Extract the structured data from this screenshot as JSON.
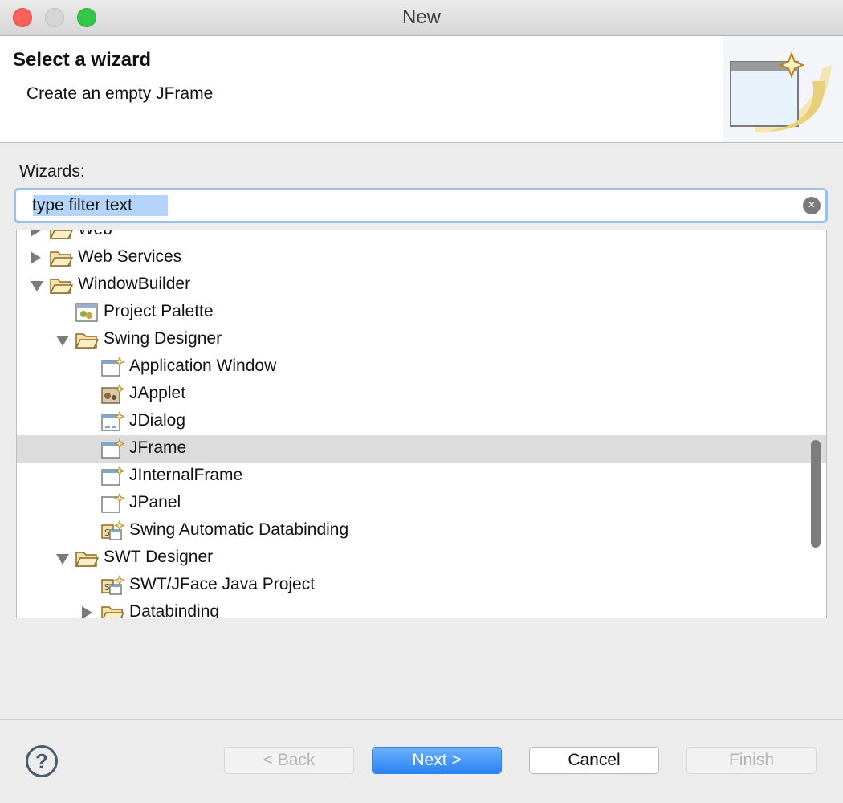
{
  "window": {
    "title": "New"
  },
  "header": {
    "title": "Select a wizard",
    "description": "Create an empty JFrame"
  },
  "wizards_label": "Wizards:",
  "filter": {
    "value": "type filter text",
    "placeholder": "type filter text"
  },
  "tree": {
    "items": [
      {
        "label": "Web",
        "expander": "closed",
        "icon": "folder-icon",
        "level": 0
      },
      {
        "label": "Web Services",
        "expander": "closed",
        "icon": "folder-icon",
        "level": 0
      },
      {
        "label": "WindowBuilder",
        "expander": "open",
        "icon": "folder-icon",
        "level": 0
      },
      {
        "label": "Project Palette",
        "expander": "none",
        "icon": "palette-icon",
        "level": 1
      },
      {
        "label": "Swing Designer",
        "expander": "open",
        "icon": "folder-icon",
        "level": 1
      },
      {
        "label": "Application Window",
        "expander": "none",
        "icon": "window-icon",
        "level": 2
      },
      {
        "label": "JApplet",
        "expander": "none",
        "icon": "applet-icon",
        "level": 2
      },
      {
        "label": "JDialog",
        "expander": "none",
        "icon": "dialog-icon",
        "level": 2
      },
      {
        "label": "JFrame",
        "expander": "none",
        "icon": "window-icon",
        "level": 2,
        "selected": true
      },
      {
        "label": "JInternalFrame",
        "expander": "none",
        "icon": "window-icon",
        "level": 2
      },
      {
        "label": "JPanel",
        "expander": "none",
        "icon": "panel-icon",
        "level": 2
      },
      {
        "label": "Swing Automatic Databinding",
        "expander": "none",
        "icon": "databinding-icon",
        "level": 2
      },
      {
        "label": "SWT Designer",
        "expander": "open",
        "icon": "folder-icon",
        "level": 1
      },
      {
        "label": "SWT/JFace Java Project",
        "expander": "none",
        "icon": "databinding-icon",
        "level": 2
      },
      {
        "label": "Databinding",
        "expander": "closed",
        "icon": "folder-icon",
        "level": 2
      }
    ]
  },
  "buttons": {
    "help": "?",
    "back": "< Back",
    "next": "Next >",
    "cancel": "Cancel",
    "finish": "Finish"
  },
  "colors": {
    "accent": "#2a83f4",
    "selection": "#dcdcdc",
    "filter_focus": "#9ec0ec"
  }
}
